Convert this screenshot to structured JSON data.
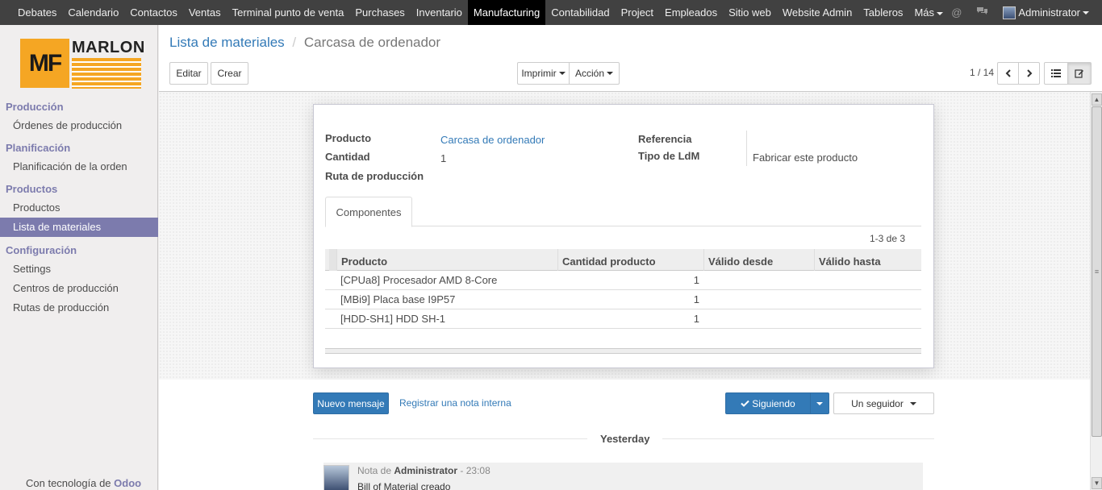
{
  "topbar": {
    "menu": [
      "Debates",
      "Calendario",
      "Contactos",
      "Ventas",
      "Terminal punto de venta",
      "Purchases",
      "Inventario",
      "Manufacturing",
      "Contabilidad",
      "Project",
      "Empleados",
      "Sitio web",
      "Website Admin",
      "Tableros",
      "Más"
    ],
    "active": "Manufacturing",
    "user": "Administrator"
  },
  "logo": {
    "mark": "MF",
    "name": "MARLON"
  },
  "sidebar": {
    "sections": [
      {
        "title": "Producción",
        "items": [
          "Órdenes de producción"
        ]
      },
      {
        "title": "Planificación",
        "items": [
          "Planificación de la orden"
        ]
      },
      {
        "title": "Productos",
        "items": [
          "Productos",
          "Lista de materiales"
        ]
      },
      {
        "title": "Configuración",
        "items": [
          "Settings",
          "Centros de producción",
          "Rutas de producción"
        ]
      }
    ],
    "active_item": "Lista de materiales",
    "powered_prefix": "Con tecnología de",
    "powered_brand": "Odoo"
  },
  "control_panel": {
    "breadcrumb_parent": "Lista de materiales",
    "breadcrumb_current": "Carcasa de ordenador",
    "edit_label": "Editar",
    "create_label": "Crear",
    "print_label": "Imprimir",
    "action_label": "Acción",
    "pager": "1 / 14"
  },
  "form": {
    "product_label": "Producto",
    "product_value": "Carcasa de ordenador",
    "quantity_label": "Cantidad",
    "quantity_value": "1",
    "route_label": "Ruta de producción",
    "reference_label": "Referencia",
    "bom_type_label": "Tipo de LdM",
    "bom_type_value": "Fabricar este producto",
    "tab_label": "Componentes",
    "record_count": "1-3 de 3",
    "columns": [
      "Producto",
      "Cantidad producto",
      "Válido desde",
      "Válido hasta"
    ],
    "rows": [
      {
        "product": "[CPUa8] Procesador AMD 8-Core",
        "qty": "1"
      },
      {
        "product": "[MBi9] Placa base I9P57",
        "qty": "1"
      },
      {
        "product": "[HDD-SH1] HDD SH-1",
        "qty": "1"
      }
    ]
  },
  "chatter": {
    "new_message_label": "Nuevo mensaje",
    "internal_note_label": "Registrar una nota interna",
    "following_label": "Siguiendo",
    "followers_label": "Un seguidor",
    "day_label": "Yesterday",
    "message": {
      "prefix": "Nota de",
      "author": "Administrator",
      "time": "- 23:08",
      "body": "Bill of Material creado"
    }
  },
  "colors": {
    "topbar_bg": "#414141",
    "accent": "#7c7bad",
    "link": "#337ab7",
    "primary_button": "#337ab7"
  }
}
